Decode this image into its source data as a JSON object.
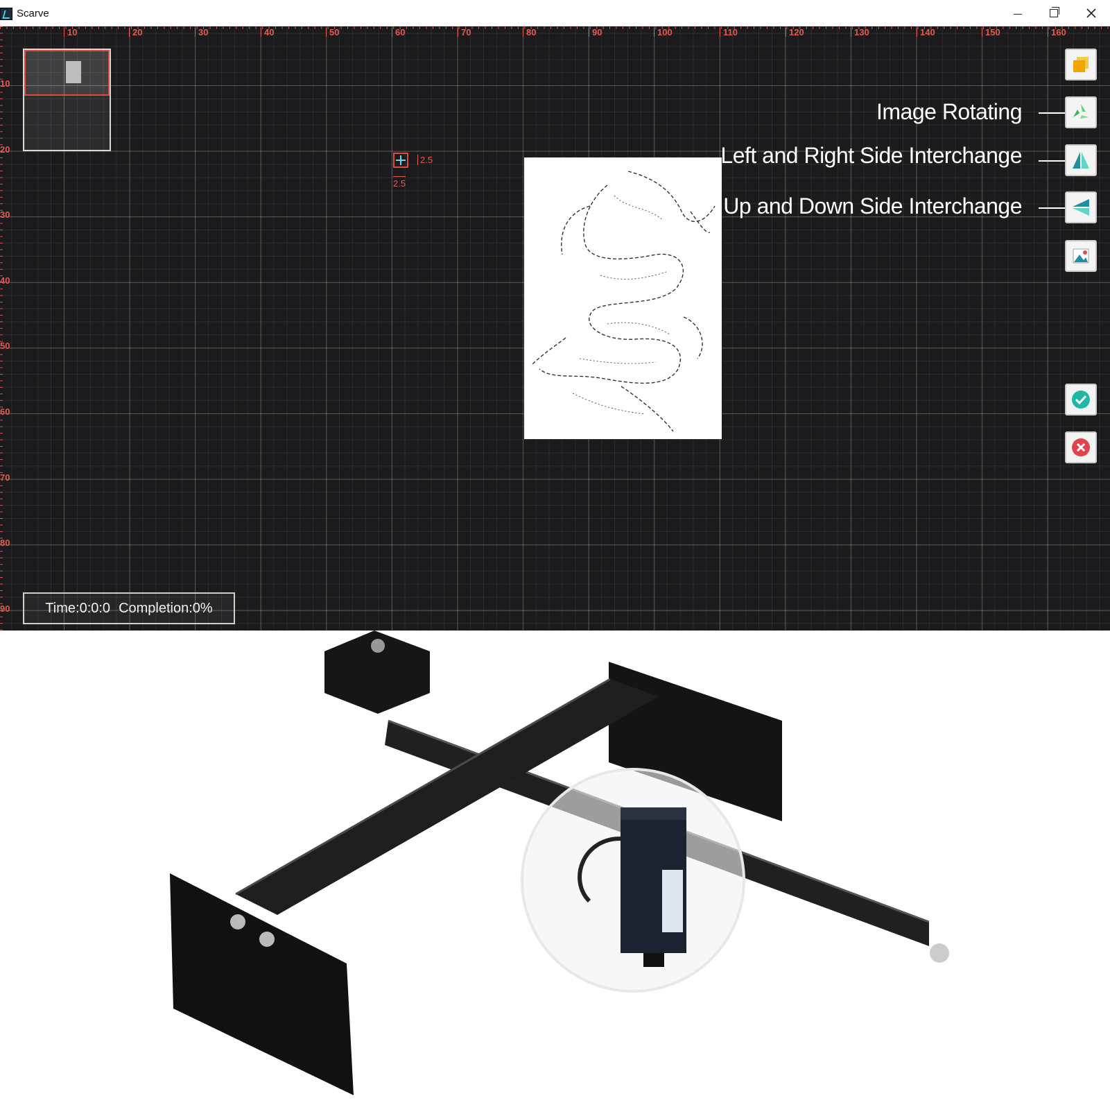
{
  "window": {
    "title": "Scarve"
  },
  "ruler": {
    "x_ticks": [
      "10",
      "20",
      "30",
      "40",
      "50",
      "60",
      "70",
      "80",
      "90",
      "100",
      "110",
      "120",
      "130",
      "140",
      "150",
      "160"
    ],
    "y_ticks": [
      "10",
      "20",
      "30",
      "40",
      "50",
      "60",
      "70",
      "80",
      "90"
    ]
  },
  "selection": {
    "width_label": "2.5",
    "height_label": "2.5"
  },
  "tools": {
    "rotate_label": "Image Rotating",
    "flip_lr_label": "Left and Right Side Interchange",
    "flip_ud_label": "Up and Down Side Interchange"
  },
  "status": {
    "time": "Time:0:0:0",
    "completion": "Completion:0%"
  },
  "icons": [
    "app-icon",
    "layers-icon",
    "rotate-icon",
    "flip-horizontal-icon",
    "flip-vertical-icon",
    "image-icon",
    "confirm-icon",
    "cancel-icon",
    "dragon-artwork",
    "laser-engraver-photo"
  ],
  "colors": {
    "canvas": "#1b1b1d",
    "ruler": "#e05a4e",
    "confirm": "#1fb8a4",
    "cancel": "#e0434b"
  }
}
